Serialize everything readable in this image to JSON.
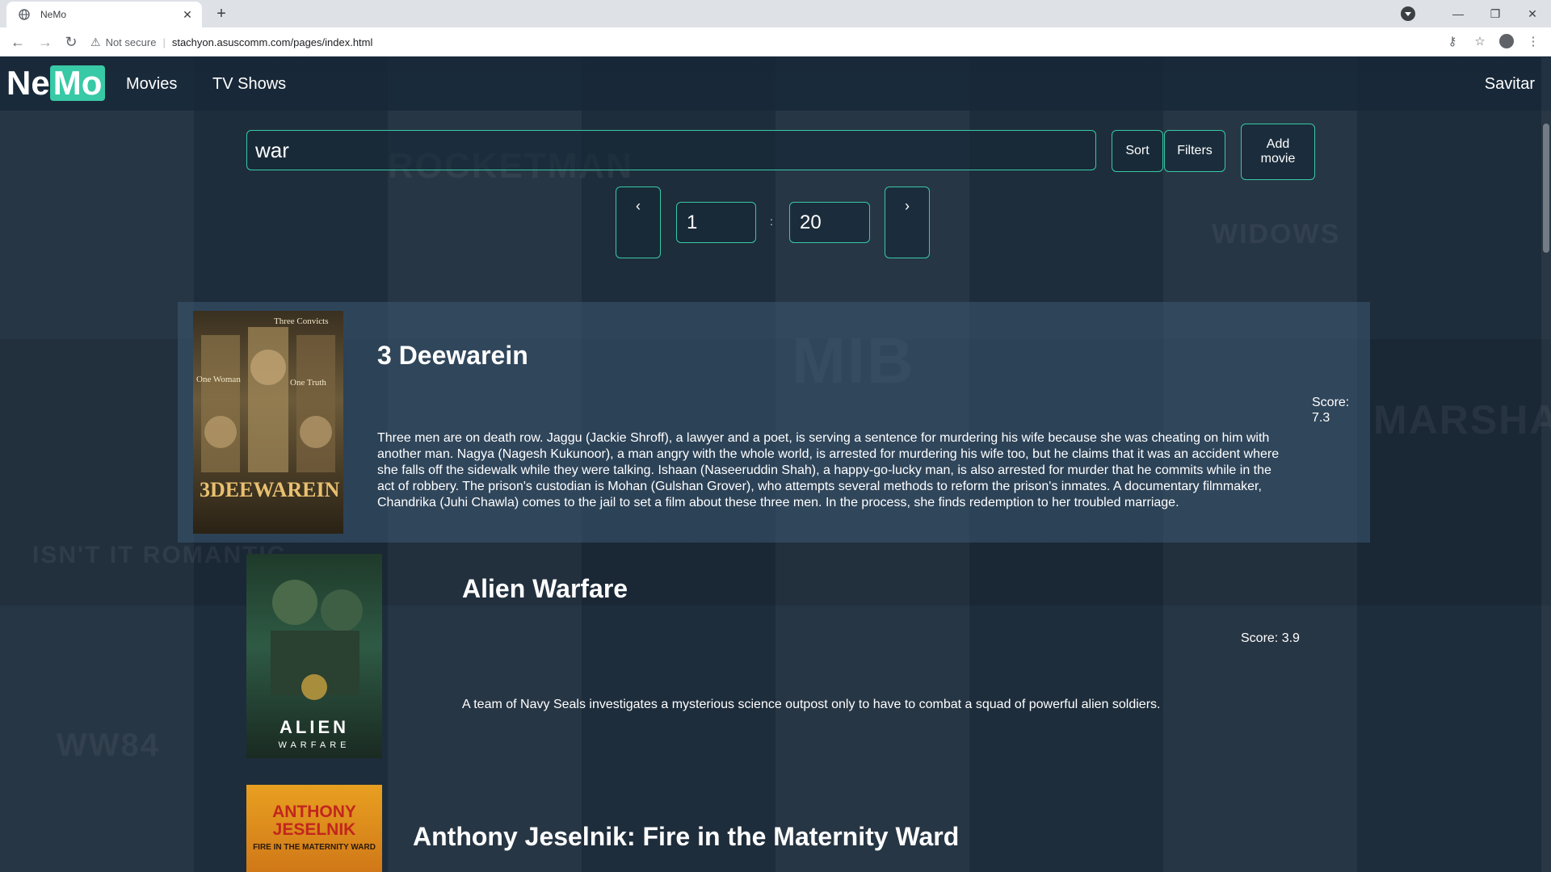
{
  "browser": {
    "tab_title": "NeMo",
    "not_secure": "Not secure",
    "url": "stachyon.asuscomm.com/pages/index.html"
  },
  "nav": {
    "logo_ne": "Ne",
    "logo_mo": "Mo",
    "links": [
      "Movies",
      "TV Shows"
    ],
    "user": "Savitar"
  },
  "search": {
    "value": "war"
  },
  "controls": {
    "sort": "Sort",
    "filters": "Filters",
    "add_movie": "Add movie"
  },
  "pagination": {
    "prev": "‹",
    "next": "›",
    "page": "1",
    "per_page": "20",
    "separator": ":"
  },
  "movies": [
    {
      "title": "3 Deewarein",
      "score_label": "Score:",
      "score": "7.3",
      "description": "Three men are on death row. Jaggu (Jackie Shroff), a lawyer and a poet, is serving a sentence for murdering his wife because she was cheating on him with another man. Nagya (Nagesh Kukunoor), a man angry with the whole world, is arrested for murdering his wife too, but he claims that it was an accident where she falls off the sidewalk while they were talking. Ishaan (Naseeruddin Shah), a happy-go-lucky man, is also arrested for murder that he commits while in the act of robbery. The prison's custodian is Mohan (Gulshan Grover), who attempts several methods to reform the prison's inmates. A documentary filmmaker, Chandrika (Juhi Chawla) comes to the jail to set a film about these three men. In the process, she finds redemption to her troubled marriage.",
      "poster_text": [
        "Three Convicts",
        "One Woman",
        "One Truth",
        "3DEEWAREIN"
      ]
    },
    {
      "title": "Alien Warfare",
      "score_label": "Score: 3.9",
      "description": "A team of Navy Seals investigates a mysterious science outpost only to have to combat a squad of powerful alien soldiers.",
      "poster_text": [
        "ALIEN",
        "WARFARE"
      ]
    },
    {
      "title": "Anthony Jeselnik: Fire in the Maternity Ward",
      "poster_text": [
        "ANTHONY",
        "JESELNIK",
        "FIRE IN THE MATERNITY WARD"
      ]
    }
  ],
  "colors": {
    "accent": "#38c9a6",
    "page_bg": "#1c2b3a",
    "navbar_bg": "#182838"
  }
}
